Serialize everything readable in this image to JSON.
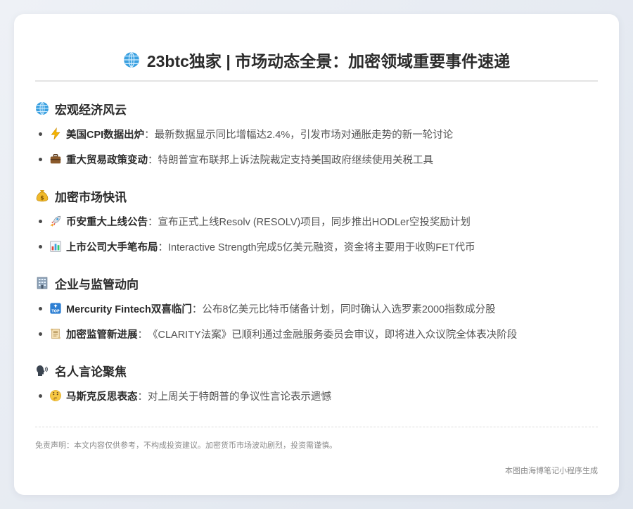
{
  "title": "23btc独家 | 市场动态全景：加密领域重要事件速递",
  "sections": [
    {
      "heading": "宏观经济风云",
      "icon": "globe-icon",
      "items": [
        {
          "icon": "lightning-icon",
          "label": "美国CPI数据出炉",
          "sep": "：",
          "text": "最新数据显示同比增幅达2.4%，引发市场对通胀走势的新一轮讨论"
        },
        {
          "icon": "briefcase-icon",
          "label": "重大贸易政策变动",
          "sep": "：",
          "text": "特朗普宣布联邦上诉法院裁定支持美国政府继续使用关税工具"
        }
      ]
    },
    {
      "heading": "加密市场快讯",
      "icon": "money-bag-icon",
      "items": [
        {
          "icon": "rocket-icon",
          "label": "币安重大上线公告",
          "sep": "：",
          "text": "宣布正式上线Resolv (RESOLV)项目，同步推出HODLer空投奖励计划"
        },
        {
          "icon": "bar-chart-icon",
          "label": "上市公司大手笔布局",
          "sep": "：",
          "text": "Interactive Strength完成5亿美元融资，资金将主要用于收购FET代币"
        }
      ]
    },
    {
      "heading": "企业与监管动向",
      "icon": "office-building-icon",
      "items": [
        {
          "icon": "top-arrow-icon",
          "label": "Mercurity Fintech双喜临门",
          "sep": "：",
          "text": "公布8亿美元比特币储备计划，同时确认入选罗素2000指数成分股"
        },
        {
          "icon": "scroll-icon",
          "label": "加密监管新进展",
          "sep": "：",
          "text": "《CLARITY法案》已顺利通过金融服务委员会审议，即将进入众议院全体表决阶段"
        }
      ]
    },
    {
      "heading": "名人言论聚焦",
      "icon": "speaking-head-icon",
      "items": [
        {
          "icon": "thinking-face-icon",
          "label": "马斯克反思表态",
          "sep": "：",
          "text": "对上周关于特朗普的争议性言论表示遗憾"
        }
      ]
    }
  ],
  "disclaimer": "免责声明：本文内容仅供参考，不构成投资建议。加密货币市场波动剧烈，投资需谨慎。",
  "footer": "本图由海博笔记小程序生成"
}
